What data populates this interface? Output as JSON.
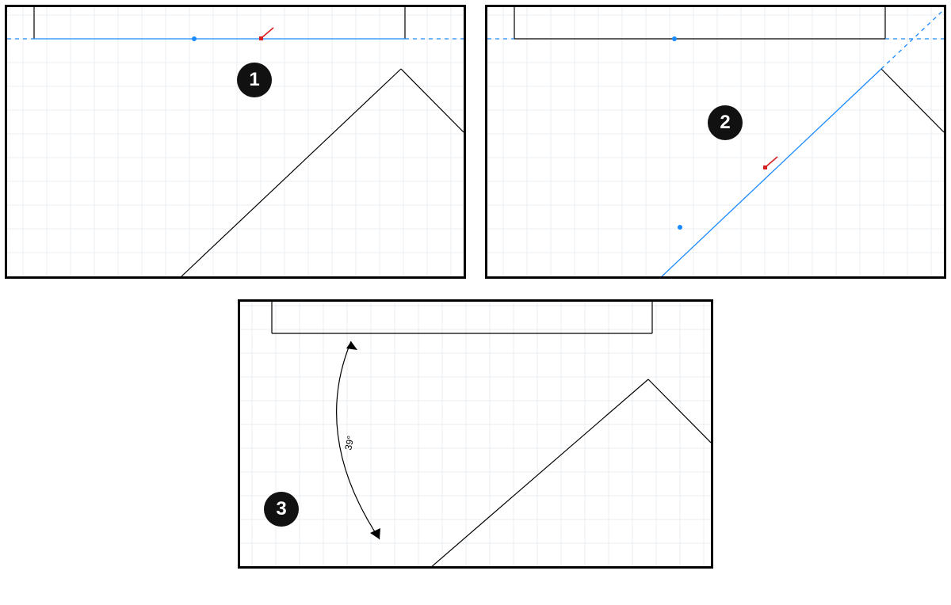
{
  "steps": [
    {
      "label": "1"
    },
    {
      "label": "2"
    },
    {
      "label": "3",
      "angle_label": "39°"
    }
  ],
  "colors": {
    "guide": "#1989ff",
    "cursor": "#d4201f",
    "border": "#000000",
    "grid": "#e9eef2"
  }
}
